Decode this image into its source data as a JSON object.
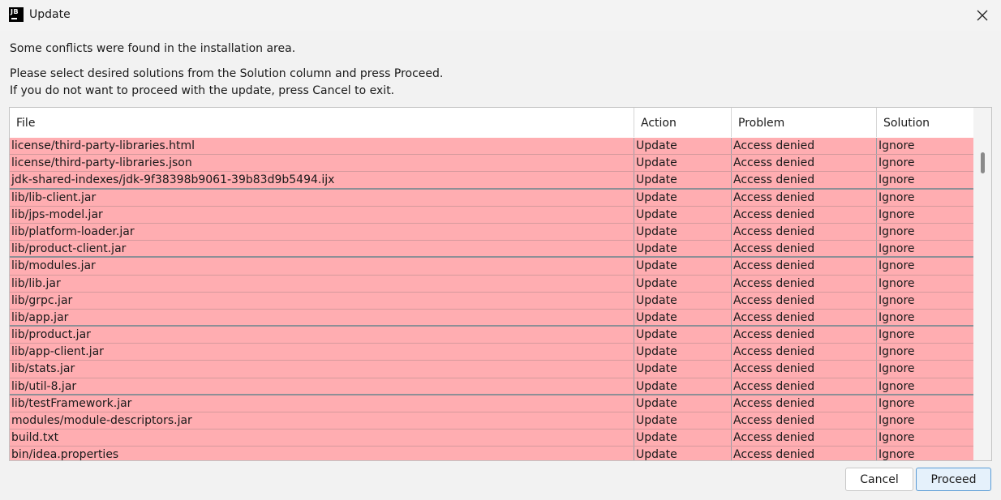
{
  "window": {
    "title": "Update",
    "icon_text": "JB",
    "close_glyph": "✕"
  },
  "messages": {
    "line1": "Some conflicts were found in the installation area.",
    "line2": "Please select desired solutions from the Solution column and press Proceed.",
    "line3": "If you do not want to proceed with the update, press Cancel to exit."
  },
  "table": {
    "columns": [
      "File",
      "Action",
      "Problem",
      "Solution"
    ],
    "rows": [
      {
        "file": "license/third-party-libraries.html",
        "action": "Update",
        "problem": "Access denied",
        "solution": "Ignore"
      },
      {
        "file": "license/third-party-libraries.json",
        "action": "Update",
        "problem": "Access denied",
        "solution": "Ignore"
      },
      {
        "file": "jdk-shared-indexes/jdk-9f38398b9061-39b83d9b5494.ijx",
        "action": "Update",
        "problem": "Access denied",
        "solution": "Ignore"
      },
      {
        "file": "lib/lib-client.jar",
        "action": "Update",
        "problem": "Access denied",
        "solution": "Ignore"
      },
      {
        "file": "lib/jps-model.jar",
        "action": "Update",
        "problem": "Access denied",
        "solution": "Ignore"
      },
      {
        "file": "lib/platform-loader.jar",
        "action": "Update",
        "problem": "Access denied",
        "solution": "Ignore"
      },
      {
        "file": "lib/product-client.jar",
        "action": "Update",
        "problem": "Access denied",
        "solution": "Ignore"
      },
      {
        "file": "lib/modules.jar",
        "action": "Update",
        "problem": "Access denied",
        "solution": "Ignore"
      },
      {
        "file": "lib/lib.jar",
        "action": "Update",
        "problem": "Access denied",
        "solution": "Ignore"
      },
      {
        "file": "lib/grpc.jar",
        "action": "Update",
        "problem": "Access denied",
        "solution": "Ignore"
      },
      {
        "file": "lib/app.jar",
        "action": "Update",
        "problem": "Access denied",
        "solution": "Ignore"
      },
      {
        "file": "lib/product.jar",
        "action": "Update",
        "problem": "Access denied",
        "solution": "Ignore"
      },
      {
        "file": "lib/app-client.jar",
        "action": "Update",
        "problem": "Access denied",
        "solution": "Ignore"
      },
      {
        "file": "lib/stats.jar",
        "action": "Update",
        "problem": "Access denied",
        "solution": "Ignore"
      },
      {
        "file": "lib/util-8.jar",
        "action": "Update",
        "problem": "Access denied",
        "solution": "Ignore"
      },
      {
        "file": "lib/testFramework.jar",
        "action": "Update",
        "problem": "Access denied",
        "solution": "Ignore"
      },
      {
        "file": "modules/module-descriptors.jar",
        "action": "Update",
        "problem": "Access denied",
        "solution": "Ignore"
      },
      {
        "file": "build.txt",
        "action": "Update",
        "problem": "Access denied",
        "solution": "Ignore"
      },
      {
        "file": "bin/idea.properties",
        "action": "Update",
        "problem": "Access denied",
        "solution": "Ignore"
      }
    ]
  },
  "buttons": {
    "cancel": "Cancel",
    "proceed": "Proceed"
  },
  "colors": {
    "row_conflict": "#ffadb1",
    "accent": "#5a9bd5"
  }
}
